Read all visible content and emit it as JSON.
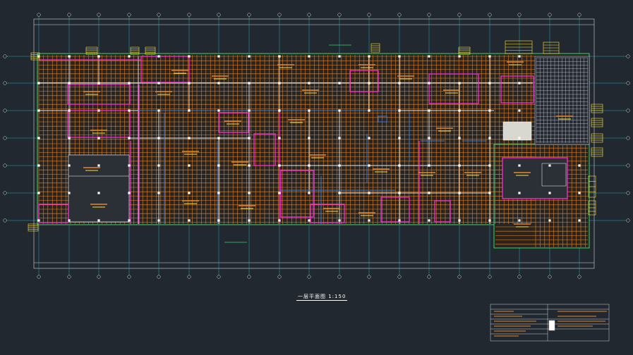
{
  "drawing": {
    "title": "一层平面图 1:150",
    "colors": {
      "background": "#212830",
      "grid": "#e8892b",
      "partition": "#e0e0e0",
      "magenta_wall": "#ff2bd6",
      "axis": "#27b7c9",
      "blue_line": "#3b7bd8",
      "yellow": "#ffe23a",
      "green": "#37d86a"
    }
  }
}
